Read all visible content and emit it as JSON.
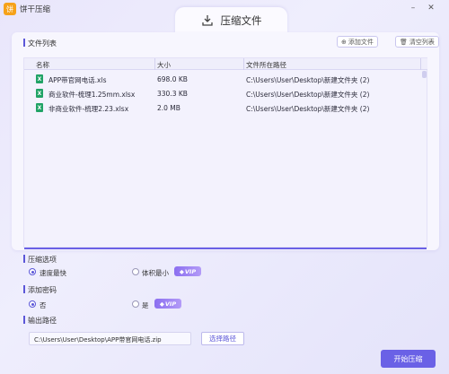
{
  "app": {
    "title": "饼干压缩",
    "logo_text": "饼"
  },
  "tab": {
    "label": "压缩文件",
    "icon": "compress-file-icon"
  },
  "file_list": {
    "section_label": "文件列表",
    "add_button": "添加文件",
    "clear_button": "清空列表",
    "columns": [
      "名称",
      "大小",
      "文件所在路径"
    ],
    "rows": [
      {
        "name": "APP带官网电话.xls",
        "size": "698.0 KB",
        "path": "C:\\Users\\User\\Desktop\\新建文件夹 (2)"
      },
      {
        "name": "商业软件-梳理1.25mm.xlsx",
        "size": "330.3 KB",
        "path": "C:\\Users\\User\\Desktop\\新建文件夹 (2)"
      },
      {
        "name": "非商业软件-梳理2.23.xlsx",
        "size": "2.0 MB",
        "path": "C:\\Users\\User\\Desktop\\新建文件夹 (2)"
      }
    ]
  },
  "compress_options": {
    "section_label": "压缩选项",
    "opt1": "速度最快",
    "opt2": "体积最小",
    "selected": "速度最快"
  },
  "password": {
    "section_label": "添加密码",
    "opt_no": "否",
    "opt_yes": "是",
    "selected": "否"
  },
  "vip_label": "VIP",
  "output": {
    "section_label": "输出路径",
    "path_value": "C:\\Users\\User\\Desktop\\APP带官网电话.zip",
    "choose_button": "选择路径"
  },
  "start_button": "开始压缩",
  "colors": {
    "accent": "#6a61e6",
    "vip": "#8b6ff0",
    "excel": "#21a366"
  }
}
